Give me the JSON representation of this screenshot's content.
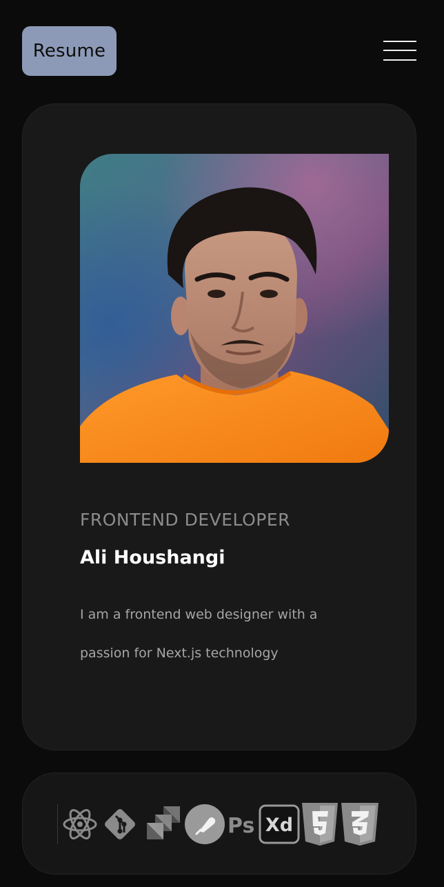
{
  "header": {
    "resume_label": "Resume",
    "menu_icon": "hamburger-menu-icon"
  },
  "profile": {
    "photo_alt": "Ali Houshangi",
    "role": "FRONTEND DEVELOPER",
    "name": "Ali Houshangi",
    "bio": "I am a frontend web designer with a passion for Next.js technology"
  },
  "skills": {
    "icons": [
      "react-icon",
      "git-icon",
      "jira-icon",
      "postman-icon",
      "photoshop-icon",
      "adobe-xd-icon",
      "html5-icon",
      "css3-icon"
    ],
    "photoshop_label": "Ps",
    "xd_label": "Xd"
  },
  "colors": {
    "background": "#0b0b0b",
    "card": "#191919",
    "resume_button": "#8d9ab7",
    "shirt": "#ff8a1e"
  }
}
